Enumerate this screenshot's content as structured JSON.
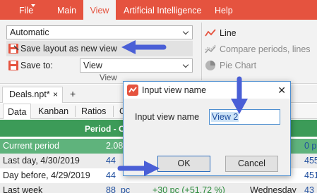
{
  "ribbon_tabs": [
    {
      "label": "File",
      "active": false
    },
    {
      "label": "Main",
      "active": false
    },
    {
      "label": "View",
      "active": true
    },
    {
      "label": "Artificial Intelligence",
      "active": false
    },
    {
      "label": "Help",
      "active": false
    }
  ],
  "view_group": {
    "mode_combo": {
      "value": "Automatic"
    },
    "save_layout_button": {
      "label": "Save layout as new view"
    },
    "save_to": {
      "label": "Save to:",
      "value": "View"
    },
    "group_label": "View"
  },
  "chart_group": {
    "line": {
      "label": "Line"
    },
    "compare": {
      "label": "Compare periods, lines"
    },
    "pie": {
      "label": "Pie Chart"
    }
  },
  "doc_tab": {
    "label": "Deals.npt*",
    "close": "×",
    "add": "+"
  },
  "view_tabs": [
    "Data",
    "Kanban",
    "Ratios",
    "C"
  ],
  "grid": {
    "header": "Period - C",
    "rows": [
      {
        "label": "Current period",
        "value": "2.08",
        "unit": "",
        "change": "",
        "weekday": "",
        "right": "0  p"
      },
      {
        "label": "Last day, 4/30/2019",
        "value": "44",
        "unit": "",
        "change": "",
        "weekday": "",
        "right": "455"
      },
      {
        "label": "Day before, 4/29/2019",
        "value": "44",
        "unit": "",
        "change": "",
        "weekday": "",
        "right": "451"
      },
      {
        "label": "Last week",
        "value": "88",
        "unit": "pc",
        "change": "+30 pc (+51.72 %)",
        "weekday": "Wednesday",
        "right": "43"
      }
    ]
  },
  "dialog": {
    "title": "Input view name",
    "close": "✕",
    "field_label": "Input view name",
    "field_value": "View 2",
    "ok_label": "OK",
    "cancel_label": "Cancel"
  },
  "colors": {
    "accent": "#e5533f",
    "grid_header": "#3c9b58",
    "grid_highlight": "#5fb37c",
    "arrow": "#4a5fd6",
    "dialog_border": "#4e8fd0"
  }
}
